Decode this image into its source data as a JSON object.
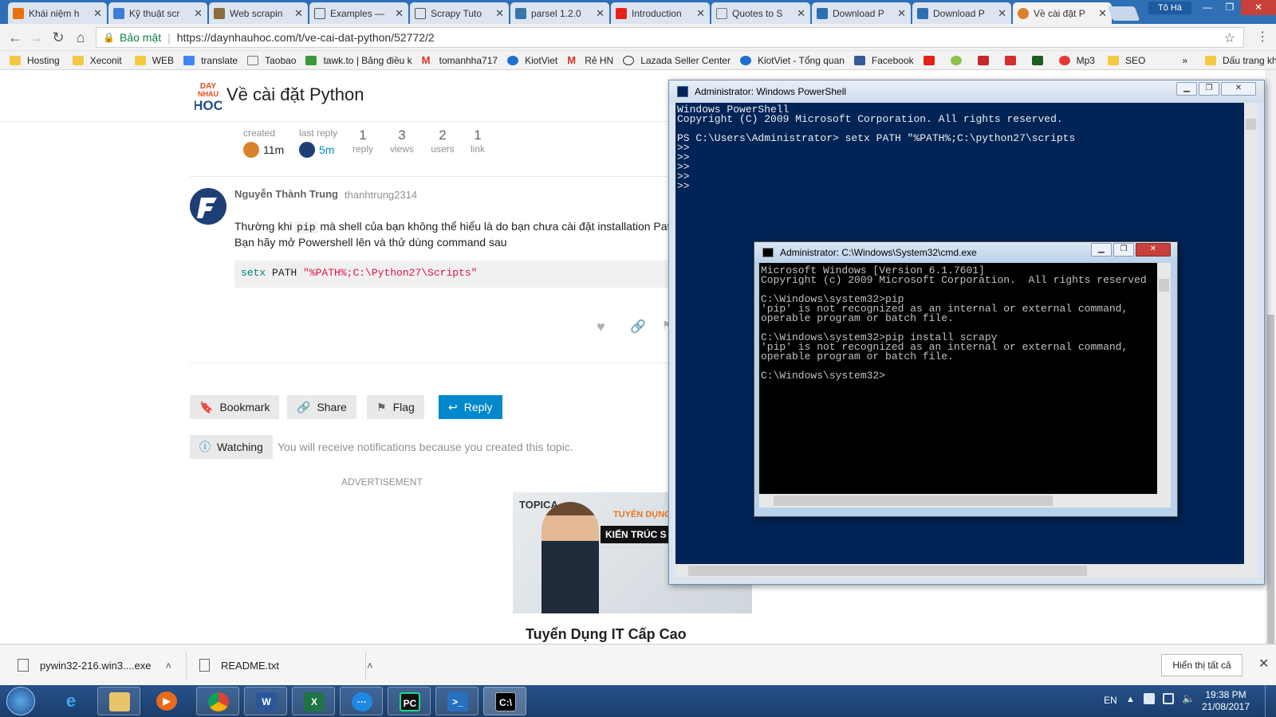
{
  "browser": {
    "tabs": [
      {
        "title": "Khái niệm h",
        "icon_color": "#e8710a"
      },
      {
        "title": "Kỹ thuật scr",
        "icon_color": "#3d7bd9"
      },
      {
        "title": "Web scrapin",
        "icon_color": "#8a6d3b"
      },
      {
        "title": "Examples —",
        "icon_color": "#555555"
      },
      {
        "title": "Scrapy Tuto",
        "icon_color": "#555555"
      },
      {
        "title": "parsel 1.2.0",
        "icon_color": "#3776ab"
      },
      {
        "title": "Introduction",
        "icon_color": "#e62117"
      },
      {
        "title": "Quotes to S",
        "icon_color": "#777777"
      },
      {
        "title": "Download P",
        "icon_color": "#2c6fb5"
      },
      {
        "title": "Download P",
        "icon_color": "#2c6fb5"
      },
      {
        "title": "Về cài đặt P",
        "icon_color": "#d9822b",
        "active": true
      }
    ],
    "profile_name": "Tô Hà",
    "address": {
      "secure_label": "Bảo mật",
      "url": "https://daynhauhoc.com/t/ve-cai-dat-python/52772/2"
    },
    "bookmarks": [
      {
        "label": "Hosting",
        "type": "folder"
      },
      {
        "label": "Xeconit",
        "type": "folder"
      },
      {
        "label": "WEB",
        "type": "folder"
      },
      {
        "label": "translate",
        "type": "link"
      },
      {
        "label": "Taobao",
        "type": "page"
      },
      {
        "label": "tawk.to | Bảng điều k",
        "type": "link"
      },
      {
        "label": "tomanhha717",
        "type": "gmail"
      },
      {
        "label": "KiotViet",
        "type": "link"
      },
      {
        "label": "Rẻ HN",
        "type": "gmail"
      },
      {
        "label": "Lazada Seller Center",
        "type": "link"
      },
      {
        "label": "KiotViet - Tổng quan",
        "type": "link"
      },
      {
        "label": "Facebook",
        "type": "facebook"
      },
      {
        "label": "Mp3",
        "type": "link"
      },
      {
        "label": "SEO",
        "type": "folder"
      }
    ],
    "bookmarks_overflow": "»",
    "other_bookmarks": "Dấu trang khác"
  },
  "topic": {
    "site_logo_text": "DAY NHAU HOC",
    "title": "Về cài đặt Python",
    "meta": {
      "created_label": "created",
      "created_value": "11m",
      "last_reply_label": "last reply",
      "last_reply_value": "5m",
      "replies_count": "1",
      "replies_label": "reply",
      "views_count": "3",
      "views_label": "views",
      "users_count": "2",
      "users_label": "users",
      "links_count": "1",
      "links_label": "link"
    }
  },
  "post": {
    "author_name": "Nguyễn Thành Trung",
    "author_username": "thanhtrung2314",
    "para1_before": "Thường khi ",
    "para1_code": "pip",
    "para1_after": " mà shell của bạn không thể hiểu là do bạn chưa cài đặt installation Pat",
    "para2": "Bạn hãy mở Powershell lên và thử dùng command sau",
    "code_kw": "setx",
    "code_mid": " PATH ",
    "code_str": "\"%PATH%;C:\\Python27\\Scripts\""
  },
  "actions": {
    "bookmark": "Bookmark",
    "share": "Share",
    "flag": "Flag",
    "reply": "Reply",
    "watching": "Watching",
    "watching_note": "You will receive notifications because you created this topic."
  },
  "ad": {
    "label": "ADVERTISEMENT",
    "brand": "TOPICA",
    "tagline": "TUYỂN DỤNG:",
    "headline": "KIẾN TRÚC S",
    "title": "Tuyển Dụng IT Cấp Cao"
  },
  "powershell": {
    "title": "Administrator: Windows PowerShell",
    "lines": "Windows PowerShell\nCopyright (C) 2009 Microsoft Corporation. All rights reserved.\n\nPS C:\\Users\\Administrator> setx PATH \"%PATH%;C:\\python27\\scripts\n>>\n>>\n>>\n>>\n>>"
  },
  "cmd": {
    "title": "Administrator: C:\\Windows\\System32\\cmd.exe",
    "lines": "Microsoft Windows [Version 6.1.7601]\nCopyright (c) 2009 Microsoft Corporation.  All rights reserved\n\nC:\\Windows\\system32>pip\n'pip' is not recognized as an internal or external command,\noperable program or batch file.\n\nC:\\Windows\\system32>pip install scrapy\n'pip' is not recognized as an internal or external command,\noperable program or batch file.\n\nC:\\Windows\\system32>"
  },
  "downloads": {
    "items": [
      {
        "name": "pywin32-216.win3....exe"
      },
      {
        "name": "README.txt"
      }
    ],
    "show_all": "Hiển thị tất cả"
  },
  "taskbar": {
    "language": "EN",
    "time": "19:38 PM",
    "date": "21/08/2017",
    "apps": [
      "ie-icon",
      "explorer-icon",
      "media-player-icon",
      "chrome-icon",
      "word-icon",
      "excel-icon",
      "messenger-icon",
      "pycharm-icon",
      "powershell-icon",
      "cmd-icon"
    ]
  }
}
